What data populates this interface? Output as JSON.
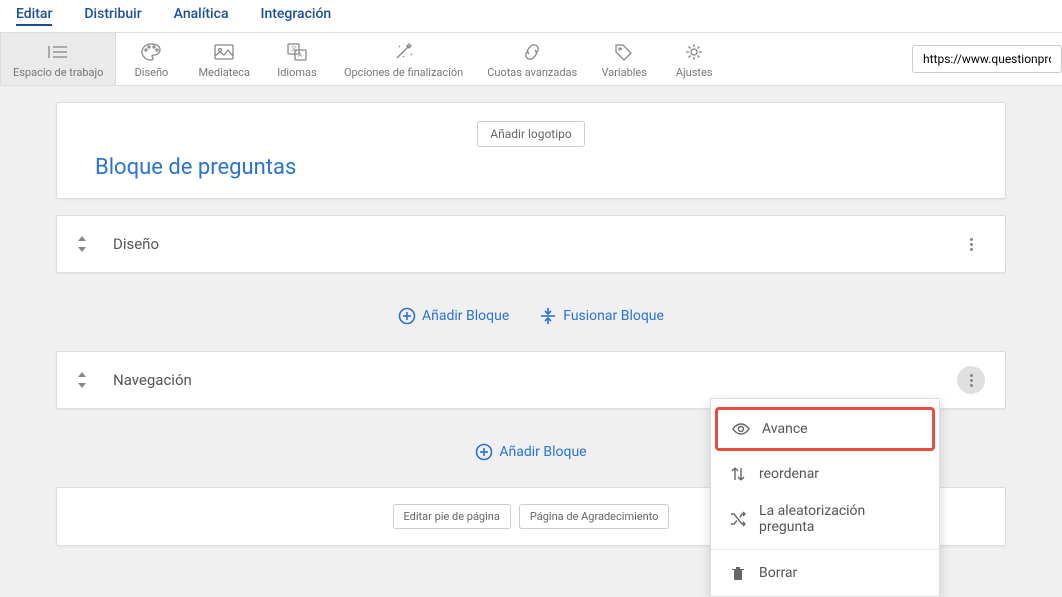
{
  "top_nav": {
    "editar": "Editar",
    "distribuir": "Distribuir",
    "analitica": "Analítica",
    "integracion": "Integración"
  },
  "toolbar": {
    "espacio": "Espacio de trabajo",
    "diseno": "Diseño",
    "mediateca": "Mediateca",
    "idiomas": "Idiomas",
    "opciones": "Opciones de finalización",
    "cuotas": "Cuotas avanzadas",
    "variables": "Variables",
    "ajustes": "Ajustes",
    "url_value": "https://www.questionpro.c"
  },
  "header_card": {
    "logo_btn": "Añadir logotipo",
    "title": "Bloque de preguntas"
  },
  "block_diseno": {
    "title": "Diseño"
  },
  "actions": {
    "add_block": "Añadir Bloque",
    "merge_block": "Fusionar Bloque"
  },
  "block_nav": {
    "title": "Navegación"
  },
  "footer": {
    "edit_footer": "Editar pie de página",
    "thanks_page": "Página de Agradecimiento"
  },
  "menu": {
    "avance": "Avance",
    "reordenar": "reordenar",
    "aleatorizacion": "La aleatorización pregunta",
    "borrar": "Borrar"
  }
}
